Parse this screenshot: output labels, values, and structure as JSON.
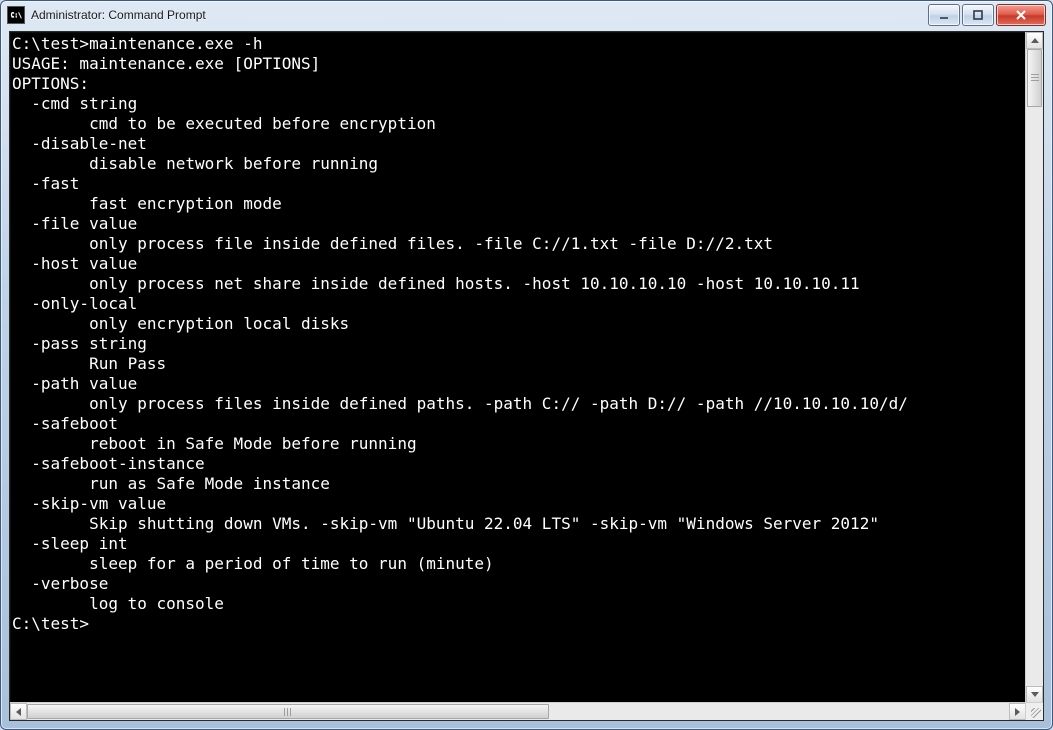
{
  "window": {
    "title": "Administrator: Command Prompt",
    "icon_label": "C:\\"
  },
  "console": {
    "prompt": "C:\\test>",
    "command": "maintenance.exe -h",
    "usage": "USAGE: maintenance.exe [OPTIONS]",
    "options_header": "OPTIONS:",
    "options": [
      {
        "flag": "-cmd string",
        "desc": "cmd to be executed before encryption"
      },
      {
        "flag": "-disable-net",
        "desc": "disable network before running"
      },
      {
        "flag": "-fast",
        "desc": "fast encryption mode"
      },
      {
        "flag": "-file value",
        "desc": "only process file inside defined files. -file C://1.txt -file D://2.txt"
      },
      {
        "flag": "-host value",
        "desc": "only process net share inside defined hosts. -host 10.10.10.10 -host 10.10.10.11"
      },
      {
        "flag": "-only-local",
        "desc": "only encryption local disks"
      },
      {
        "flag": "-pass string",
        "desc": "Run Pass"
      },
      {
        "flag": "-path value",
        "desc": "only process files inside defined paths. -path C:// -path D:// -path //10.10.10.10/d/"
      },
      {
        "flag": "-safeboot",
        "desc": "reboot in Safe Mode before running"
      },
      {
        "flag": "-safeboot-instance",
        "desc": "run as Safe Mode instance"
      },
      {
        "flag": "-skip-vm value",
        "desc": "Skip shutting down VMs. -skip-vm \"Ubuntu 22.04 LTS\" -skip-vm \"Windows Server 2012\""
      },
      {
        "flag": "-sleep int",
        "desc": "sleep for a period of time to run (minute)"
      },
      {
        "flag": "-verbose",
        "desc": "log to console"
      }
    ],
    "trailing_prompt": "C:\\test>"
  }
}
